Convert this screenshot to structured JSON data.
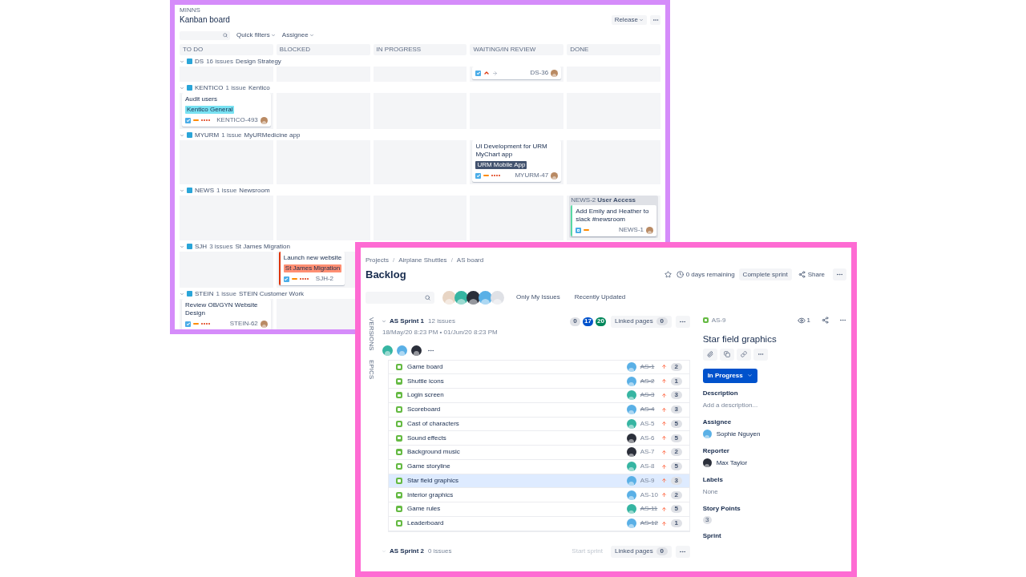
{
  "board": {
    "project": "MINNS",
    "title": "Kanban board",
    "release": "Release",
    "filters": [
      {
        "label": "Quick filters"
      },
      {
        "label": "Assignee"
      }
    ],
    "columns": [
      "TO DO",
      "BLOCKED",
      "IN PROGRESS",
      "WAITING/IN REVIEW",
      "DONE"
    ],
    "lanes": [
      {
        "key": "DS",
        "count": "16 issues",
        "name": "Design Strategy",
        "expanded": true,
        "cells": [
          {
            "kind": "empty"
          },
          {
            "kind": "empty"
          },
          {
            "kind": "empty"
          },
          {
            "kind": "card",
            "marks": [
              {
                "kind": "checkbox"
              },
              {
                "kind": "chevron"
              },
              {
                "kind": "arrow"
              }
            ],
            "key": "DS-36",
            "avatar": {
              "color": "#b98a63"
            }
          },
          {
            "kind": "empty"
          }
        ]
      },
      {
        "key": "KENTICO",
        "count": "1 issue",
        "name": "Kentico",
        "expanded": true,
        "cells": [
          {
            "kind": "card",
            "title": "Audit users",
            "tag": {
              "text": "Kentico General",
              "color": "#79e2f2"
            },
            "marks": [
              {
                "kind": "checkbox"
              },
              {
                "kind": "dash"
              },
              {
                "kind": "dots"
              }
            ],
            "key": "KENTICO-493",
            "avatar": {
              "color": "#b98a63"
            }
          },
          {
            "kind": "empty"
          },
          {
            "kind": "empty"
          },
          {
            "kind": "empty"
          },
          {
            "kind": "empty"
          }
        ]
      },
      {
        "key": "MYURM",
        "count": "1 issue",
        "name": "MyURMedicine app",
        "expanded": true,
        "cells": [
          {
            "kind": "empty"
          },
          {
            "kind": "empty"
          },
          {
            "kind": "empty"
          },
          {
            "kind": "card",
            "title": "UI Development for URM MyChart app",
            "tag": {
              "text": "URM Mobile App",
              "color": "#42526e"
            },
            "marks": [
              {
                "kind": "checkbox"
              },
              {
                "kind": "dash"
              },
              {
                "kind": "dots"
              }
            ],
            "key": "MYURM-47",
            "avatar": {
              "color": "#b98a63"
            }
          },
          {
            "kind": "empty"
          }
        ]
      },
      {
        "key": "NEWS",
        "count": "1 issue",
        "name": "Newsroom",
        "expanded": true,
        "cells": [
          {
            "kind": "empty"
          },
          {
            "kind": "empty"
          },
          {
            "kind": "empty"
          },
          {
            "kind": "empty"
          },
          {
            "kind": "card",
            "group": {
              "key": "NEWS-2",
              "name": "User Access"
            },
            "color": "#57d9a3",
            "title": "Add Emily and Heather to slack #newsroom",
            "marks": [
              {
                "kind": "subtask"
              },
              {
                "kind": "dash"
              }
            ],
            "key": "NEWS-1",
            "avatar": {
              "color": "#b98a63"
            }
          }
        ]
      },
      {
        "key": "SJH",
        "count": "3 issues",
        "name": "St James Migration",
        "expanded": true,
        "cells": [
          {
            "kind": "empty"
          },
          {
            "kind": "card",
            "color": "#de350b",
            "title": "Launch new website",
            "tag": {
              "text": "St James Migration",
              "color": "#ff8f73"
            },
            "marks": [
              {
                "kind": "checkbox"
              },
              {
                "kind": "dash"
              },
              {
                "kind": "dots"
              }
            ],
            "key": "SJH-2"
          }
        ]
      },
      {
        "key": "STEIN",
        "count": "1 issue",
        "name": "STEIN Customer Work",
        "expanded": true,
        "cells": [
          {
            "kind": "card",
            "title": "Review OB/GYN Website Design",
            "marks": [
              {
                "kind": "checkbox"
              },
              {
                "kind": "dash"
              },
              {
                "kind": "dots"
              }
            ],
            "key": "STEIN-62",
            "avatar": {
              "color": "#b98a63"
            }
          },
          {
            "kind": "empty"
          }
        ]
      }
    ]
  },
  "backlog": {
    "breadcrumbs": [
      {
        "kind": "link",
        "text": "Projects"
      },
      {
        "kind": "separator",
        "text": "/"
      },
      {
        "kind": "link",
        "text": "Airplane Shuttles"
      },
      {
        "kind": "separator",
        "text": "/"
      },
      {
        "kind": "link",
        "text": "AS board"
      }
    ],
    "title": "Backlog",
    "remaining": "0 days remaining",
    "complete": "Complete sprint",
    "share": "Share",
    "people": [
      {
        "color": "#e8d5c4"
      },
      {
        "color": "#36b5a2"
      },
      {
        "color": "#2b2f3a"
      },
      {
        "color": "#5ab0e6"
      },
      {
        "color": "#dfe1e6"
      }
    ],
    "quick_filters": [
      "Only My Issues",
      "Recently Updated"
    ],
    "side_tabs": [
      "VERSIONS",
      "EPICS"
    ],
    "sprints": [
      {
        "name": "AS Sprint 1",
        "count": "12 issues",
        "expanded": true,
        "dates": "18/May/20 8:23 PM • 01/Jun/20 8:23 PM",
        "badges": [
          {
            "text": "0",
            "color": "#dfe1e6"
          },
          {
            "text": "17",
            "color": "#0052cc"
          },
          {
            "text": "20",
            "color": "#00875a"
          }
        ],
        "linked": "Linked pages",
        "linked_count": "0",
        "assignees": [
          {
            "color": "#36b5a2"
          },
          {
            "color": "#5ab0e6"
          },
          {
            "color": "#2b2f3a"
          }
        ],
        "issues": [
          {
            "title": "Game board",
            "key": "AS-1",
            "done": true,
            "points": "2",
            "avatar": {
              "color": "#5ab0e6"
            },
            "selected": false
          },
          {
            "title": "Shuttle icons",
            "key": "AS-2",
            "done": true,
            "points": "1",
            "avatar": {
              "color": "#5ab0e6"
            },
            "selected": false
          },
          {
            "title": "Login screen",
            "key": "AS-3",
            "done": true,
            "points": "3",
            "avatar": {
              "color": "#36b5a2"
            },
            "selected": false
          },
          {
            "title": "Scoreboard",
            "key": "AS-4",
            "done": true,
            "points": "3",
            "avatar": {
              "color": "#5ab0e6"
            },
            "selected": false
          },
          {
            "title": "Cast of characters",
            "key": "AS-5",
            "done": false,
            "points": "5",
            "avatar": {
              "color": "#36b5a2"
            },
            "selected": false
          },
          {
            "title": "Sound effects",
            "key": "AS-6",
            "done": false,
            "points": "5",
            "avatar": {
              "color": "#2b2f3a"
            },
            "selected": false
          },
          {
            "title": "Background music",
            "key": "AS-7",
            "done": false,
            "points": "2",
            "avatar": {
              "color": "#2b2f3a"
            },
            "selected": false
          },
          {
            "title": "Game storyline",
            "key": "AS-8",
            "done": false,
            "points": "5",
            "avatar": {
              "color": "#36b5a2"
            },
            "selected": false
          },
          {
            "title": "Star field graphics",
            "key": "AS-9",
            "done": false,
            "points": "3",
            "avatar": {
              "color": "#5ab0e6"
            },
            "selected": true
          },
          {
            "title": "Interior graphics",
            "key": "AS-10",
            "done": false,
            "points": "2",
            "avatar": {
              "color": "#5ab0e6"
            },
            "selected": false
          },
          {
            "title": "Game rules",
            "key": "AS-11",
            "done": true,
            "points": "5",
            "avatar": {
              "color": "#36b5a2"
            },
            "selected": false
          },
          {
            "title": "Leaderboard",
            "key": "AS-12",
            "done": true,
            "points": "1",
            "avatar": {
              "color": "#5ab0e6"
            },
            "selected": false
          }
        ]
      },
      {
        "name": "AS Sprint 2",
        "count": "0 issues",
        "expanded": false,
        "start": {
          "label": "Start sprint",
          "disabled": true
        },
        "linked": "Linked pages",
        "linked_count": "0"
      }
    ],
    "detail": {
      "key": "AS-9",
      "watchers": "1",
      "title": "Star field graphics",
      "status": "In Progress",
      "fields": [
        {
          "label": "Description",
          "kind": "placeholder",
          "value": "Add a description..."
        },
        {
          "label": "Assignee",
          "kind": "person",
          "value": "Sophie Nguyen",
          "avatar": {
            "color": "#5ab0e6"
          }
        },
        {
          "label": "Reporter",
          "kind": "person",
          "value": "Max Taylor",
          "avatar": {
            "color": "#2b2f3a"
          }
        },
        {
          "label": "Labels",
          "kind": "muted",
          "value": "None"
        },
        {
          "label": "Story Points",
          "kind": "badge",
          "value": "3"
        },
        {
          "label": "Sprint",
          "kind": "label"
        }
      ]
    }
  }
}
